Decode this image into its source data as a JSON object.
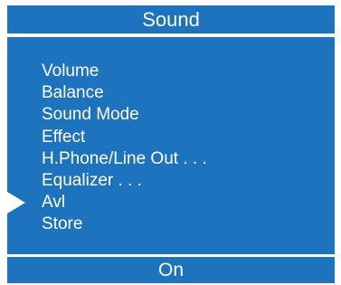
{
  "title": "Sound",
  "menu": {
    "items": [
      "Volume",
      "Balance",
      "Sound Mode",
      "Effect",
      "H.Phone/Line Out . . .",
      "Equalizer . . .",
      "Avl",
      "Store"
    ],
    "selected_index": 6
  },
  "value": "On",
  "colors": {
    "panel": "#1e73be",
    "text": "#ffffff"
  }
}
